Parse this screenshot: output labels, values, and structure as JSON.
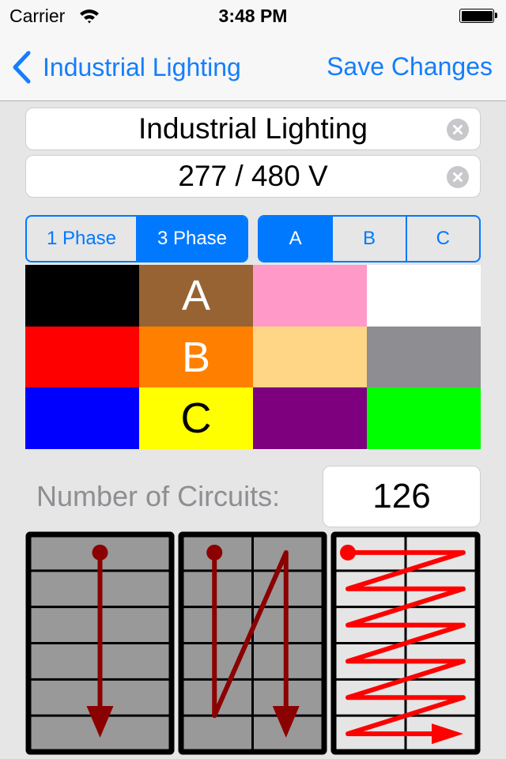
{
  "status_bar": {
    "carrier": "Carrier",
    "time": "3:48 PM",
    "wifi_icon": "wifi-icon",
    "battery_icon": "battery-full-icon"
  },
  "nav_bar": {
    "back_label": "Industrial Lighting",
    "back_icon": "chevron-left-icon",
    "save_label": "Save Changes",
    "tint_color": "#157efb"
  },
  "form": {
    "name_value": "Industrial Lighting",
    "voltage_value": "277 / 480 V",
    "clear_icon": "clear-circle-icon"
  },
  "phase_selector": {
    "options": [
      "1 Phase",
      "3 Phase"
    ],
    "selected": "3 Phase"
  },
  "leg_selector": {
    "options": [
      "A",
      "B",
      "C"
    ],
    "selected": "A"
  },
  "accent_color": "#0079ff",
  "wire_colors": [
    {
      "name": "black",
      "color": "#000000",
      "label": "",
      "text_color": "#ffffff"
    },
    {
      "name": "brown",
      "color": "#976333",
      "label": "A",
      "text_color": "#ffffff"
    },
    {
      "name": "pink",
      "color": "#ff99c8",
      "label": "",
      "text_color": "#ffffff"
    },
    {
      "name": "white",
      "color": "#ffffff",
      "label": "",
      "text_color": "#000000"
    },
    {
      "name": "red",
      "color": "#ff0000",
      "label": "",
      "text_color": "#ffffff"
    },
    {
      "name": "orange",
      "color": "#ff7f00",
      "label": "B",
      "text_color": "#ffffff"
    },
    {
      "name": "tan",
      "color": "#ffd686",
      "label": "",
      "text_color": "#000000"
    },
    {
      "name": "gray",
      "color": "#8e8d92",
      "label": "",
      "text_color": "#ffffff"
    },
    {
      "name": "blue",
      "color": "#0000ff",
      "label": "",
      "text_color": "#ffffff"
    },
    {
      "name": "yellow",
      "color": "#ffff00",
      "label": "C",
      "text_color": "#000000"
    },
    {
      "name": "purple",
      "color": "#7f007f",
      "label": "",
      "text_color": "#ffffff"
    },
    {
      "name": "green",
      "color": "#00ff00",
      "label": "",
      "text_color": "#000000"
    }
  ],
  "circuits": {
    "label": "Number of Circuits:",
    "value": "126"
  },
  "numbering_layouts": [
    {
      "name": "single-column-top-down",
      "columns": 1,
      "rows": 6,
      "selected": false,
      "path_color": "#8b0000",
      "cell_color": "#999999"
    },
    {
      "name": "two-column-top-down",
      "columns": 2,
      "rows": 6,
      "selected": false,
      "path_color": "#8b0000",
      "cell_color": "#999999"
    },
    {
      "name": "two-column-zigzag",
      "columns": 2,
      "rows": 6,
      "selected": true,
      "path_color": "#ff0000",
      "cell_color": "#e5e5e5"
    }
  ]
}
